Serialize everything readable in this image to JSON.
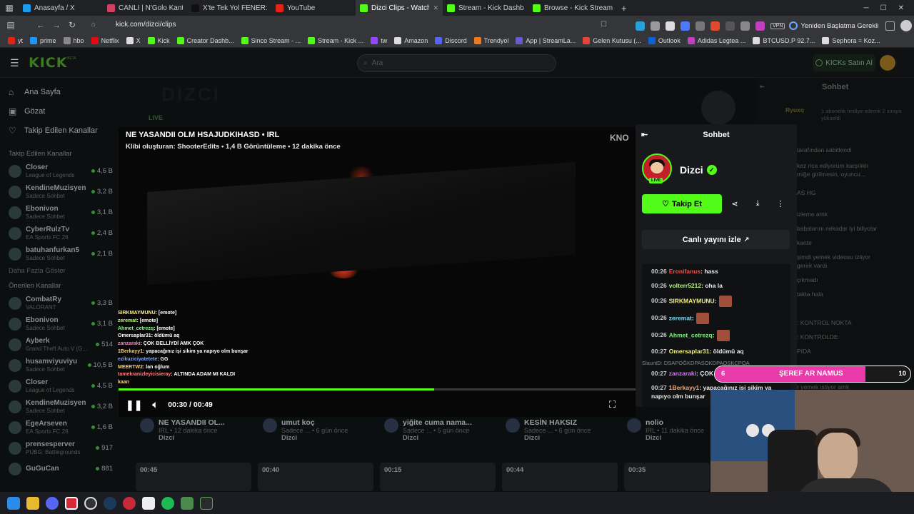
{
  "browser": {
    "tabs": [
      {
        "label": "Anasayfa / X",
        "color": "#1d9bf0",
        "active": false
      },
      {
        "label": "CANLI | N'Golo Kante Ö",
        "color": "#d04060",
        "active": false
      },
      {
        "label": "X'te Tek Yol FENER: \"Binlerc",
        "color": "#111111",
        "active": false
      },
      {
        "label": "YouTube",
        "color": "#e62117",
        "active": false
      },
      {
        "label": "Dizci Clips - Watch Live on",
        "color": "#53fc18",
        "active": true
      },
      {
        "label": "Stream - Kick Dashboard",
        "color": "#53fc18",
        "active": false
      },
      {
        "label": "Browse - Kick Streaming",
        "color": "#53fc18",
        "active": false
      }
    ],
    "new_tab": "+",
    "url": "kick.com/dizci/clips",
    "restart_label": "Yeniden Başlatma Gerekli",
    "vpn": "VPN",
    "bookmarks": [
      {
        "label": "yt",
        "color": "#e62117"
      },
      {
        "label": "prime",
        "color": "#1a98ff"
      },
      {
        "label": "hbo",
        "color": "#888888"
      },
      {
        "label": "Netflix",
        "color": "#e50914"
      },
      {
        "label": "X",
        "color": "#dddddd"
      },
      {
        "label": "Kick",
        "color": "#53fc18"
      },
      {
        "label": "Creator Dashb...",
        "color": "#53fc18"
      },
      {
        "label": "Sinco Stream - ...",
        "color": "#53fc18"
      },
      {
        "label": "Stream - Kick ...",
        "color": "#53fc18"
      },
      {
        "label": "tw",
        "color": "#9146ff"
      },
      {
        "label": "Amazon",
        "color": "#dddddd"
      },
      {
        "label": "Discord",
        "color": "#5865f2"
      },
      {
        "label": "Trendyol",
        "color": "#f27a1a"
      },
      {
        "label": "App | StreamLa...",
        "color": "#6a5acd"
      },
      {
        "label": "Gelen Kutusu (...",
        "color": "#ea4335"
      },
      {
        "label": "Outlook",
        "color": "#0a64d8"
      },
      {
        "label": "Adidas Legtea ...",
        "color": "#c040c0"
      },
      {
        "label": "BTCUSD.P 92.7...",
        "color": "#dddddd"
      },
      {
        "label": "Sephora = Koz...",
        "color": "#dddddd"
      }
    ]
  },
  "kick": {
    "logo": "KICK",
    "logo_tag": "BETA",
    "search_placeholder": "Ara",
    "kicks_button": "KICKs Satın Al"
  },
  "sidebar": {
    "nav": [
      {
        "label": "Ana Sayfa",
        "icon": "home-icon"
      },
      {
        "label": "Gözat",
        "icon": "browse-icon"
      },
      {
        "label": "Takip Edilen Kanallar",
        "icon": "heart-icon"
      }
    ],
    "followed_heading": "Takip Edilen Kanallar",
    "followed": [
      {
        "name": "Closer",
        "sub": "League of Legends",
        "count": "4,6 B"
      },
      {
        "name": "KendineMuzisyen",
        "sub": "Sadece Sohbet",
        "count": "3,2 B"
      },
      {
        "name": "Ebonivon",
        "sub": "Sadece Sohbet",
        "count": "3,1 B"
      },
      {
        "name": "CyberRulzTv",
        "sub": "EA Sports FC 26",
        "count": "2,4 B"
      },
      {
        "name": "batuhanfurkan5",
        "sub": "Sadece Sohbet",
        "count": "2,1 B"
      }
    ],
    "more_label": "Daha Fazla Göster",
    "suggested_heading": "Önerilen Kanallar",
    "suggested": [
      {
        "name": "CombatRy",
        "sub": "VALORANT",
        "count": "3,3 B"
      },
      {
        "name": "Ebonivon",
        "sub": "Sadece Sohbet",
        "count": "3,1 B"
      },
      {
        "name": "Ayberk",
        "sub": "Grand Theft Auto V (G...",
        "count": "514"
      },
      {
        "name": "husamviyuviyu",
        "sub": "Sadece Sohbet",
        "count": "10,5 B"
      },
      {
        "name": "Closer",
        "sub": "League of Legends",
        "count": "4,5 B"
      },
      {
        "name": "KendineMuzisyen",
        "sub": "Sadece Sohbet",
        "count": "3,2 B"
      },
      {
        "name": "EgeArseven",
        "sub": "EA Sports FC 26",
        "count": "1,6 B"
      },
      {
        "name": "prensesperver",
        "sub": "PUBG: Battlegrounds",
        "count": "917"
      },
      {
        "name": "GuGuCan",
        "sub": "",
        "count": "881"
      }
    ]
  },
  "page_behind": {
    "live_badge": "LIVE",
    "header_watermark": "DIZCI"
  },
  "video": {
    "title": "NE YASANDII OLM HSAJUDKIHASD • IRL",
    "subtitle": "Klibi oluşturan: ShooterEdits • 1,4 B Görüntüleme • 12 dakika önce",
    "watermark": "KNO",
    "time": "00:30 / 00:49",
    "progress": 0.61,
    "overlay_chat": [
      {
        "user": "SIRKMAYMUNU",
        "text": ": [emote]",
        "color": "#fff07a"
      },
      {
        "user": "zeremat",
        "text": ": [emote]",
        "color": "#c0ff80"
      },
      {
        "user": "Ahmet_cetrezq",
        "text": ": [emote]",
        "color": "#80ff80"
      },
      {
        "user": "Omersaplar31",
        "text": ": öldümü aq",
        "color": "#ffffff"
      },
      {
        "user": "zanzaraki",
        "text": ": ÇOK BELLİYDİ AMK ÇOK",
        "color": "#ff80c0"
      },
      {
        "user": "1Berkayy1",
        "text": ": yapacağınız işi sikim ya napıyo olm bunşar",
        "color": "#ffd060"
      },
      {
        "user": "ezikuziciyatetete",
        "text": ": GG",
        "color": "#7aa8ff"
      },
      {
        "user": "MEERTW2",
        "text": ": lan oğlum",
        "color": "#ffd060"
      },
      {
        "user": "tamekranizleyicisieray",
        "text": ": ALTINDA ADAM MI KALDI",
        "color": "#ff8080"
      },
      {
        "user": "kaan",
        "text": "",
        "color": "#ffd060"
      }
    ]
  },
  "clips": [
    {
      "title": "NE YASANDII OL...",
      "sub": "IRL • 12 dakika önce",
      "channel": "Dizci"
    },
    {
      "title": "umut koç",
      "sub": "Sadece ... • 6 gün önce",
      "channel": "Dizci"
    },
    {
      "title": "yiğite cuma nama...",
      "sub": "Sadece ... • 5 gün önce",
      "channel": "Dizci"
    },
    {
      "title": "KESİN HAKSIZ",
      "sub": "Sadece ... • 6 gün önce",
      "channel": "Dizci"
    },
    {
      "title": "nolio",
      "sub": "IRL • 11 dakika önce",
      "channel": "Dizci"
    }
  ],
  "thumbs": [
    "00:45",
    "00:40",
    "00:15",
    "00:44",
    "00:35"
  ],
  "chat_panel": {
    "title": "Sohbet",
    "channel": "Dizci",
    "live": "LIVE",
    "follow": "Takip Et",
    "watch_live": "Canlı yayını izle",
    "messages": [
      {
        "time": "00:26",
        "user": "Eronifanus",
        "text": ": hass",
        "color": "#ff4a4a",
        "emote": false
      },
      {
        "time": "00:26",
        "user": "volterr5212",
        "text": ": oha la",
        "color": "#b6f27a",
        "emote": false
      },
      {
        "time": "00:26",
        "user": "SIRKMAYMUNU",
        "text": ":",
        "color": "#f2f27a",
        "emote": true
      },
      {
        "time": "00:26",
        "user": "zeremat",
        "text": ":",
        "color": "#7ad7f2",
        "emote": true
      },
      {
        "time": "00:26",
        "user": "Ahmet_cetrezq",
        "text": ":",
        "color": "#7af27a",
        "emote": true
      },
      {
        "time": "00:27",
        "user": "Omersaplar31",
        "text": ": öldümü aq",
        "color": "#f2f27a",
        "emote": false
      },
      {
        "time": "00:27",
        "user": "zanzaraki",
        "text": ": ÇOK",
        "color": "#d27af2",
        "emote": false
      },
      {
        "time": "00:27",
        "user": "1Berkayy1",
        "text": ": yapacağınız işi sikim ya napıyo olm bunşar",
        "color": "#f2a87a",
        "emote": false
      }
    ],
    "reply_ref": "SlauntD: DSAPOĞKDPASOKDPAOSKCPOA"
  },
  "page_chat": {
    "title": "Sohbet",
    "pinned_user": "Ryuxq",
    "pinned_text": "1 abonelik hediye ederek 2 sıraya yükseldi",
    "lines": [
      "tarafından sabitlendi",
      "kez rica ediyorum karşılıklı",
      "miğe girilmesin, oyuncu...",
      "AS HG",
      "izleme amk",
      "babalarını nekadar iyi biliyolar",
      "kante",
      "şimdi yemek videosu izliyor",
      "gerek vardı",
      "çıkmadı",
      "takta hala",
      ": KONTROL NOKTA",
      ": KONTROLDE",
      "PIDA",
      "r yemek istiyor amk"
    ]
  },
  "overlay": {
    "left_num": "6",
    "label": "ŞEREF AR NAMUS",
    "right_num": "10",
    "fill": 0.77
  },
  "colors": {
    "kick_green": "#53fc18",
    "pink": "#e83aa8"
  }
}
